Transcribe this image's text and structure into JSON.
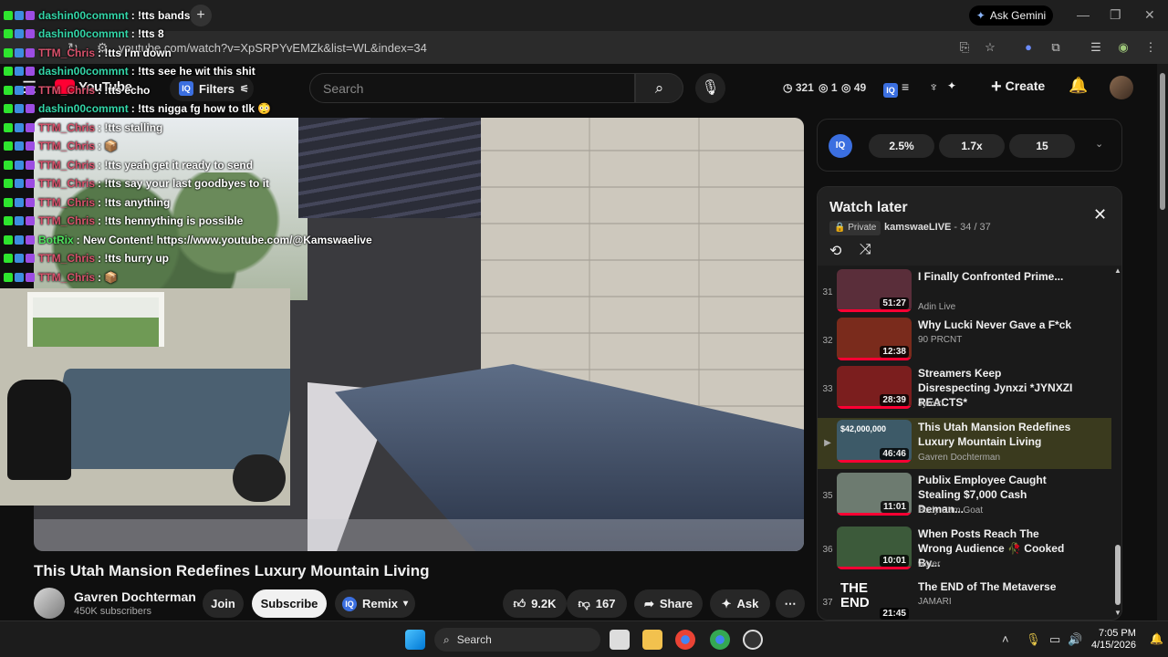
{
  "browser": {
    "gemini_label": "Ask Gemini",
    "url": "youtube.com/watch?v=XpSRPYvEMZk&list=WL&index=34"
  },
  "youtube": {
    "logo": "YouTube",
    "filters_label": "Filters",
    "search_placeholder": "Search",
    "stats": {
      "a": "321",
      "b": "1",
      "c": "49"
    },
    "create_label": "Create"
  },
  "chat": [
    {
      "user": "dashin00commnt",
      "color": "#33d6a8",
      "msg": ": !tts 8"
    },
    {
      "user": "TTM_Chris",
      "color": "#d9526c",
      "msg": ": !tts I'm down"
    },
    {
      "user": "dashin00commnt",
      "color": "#33d6a8",
      "msg": ": !tts see he wit this shit"
    },
    {
      "user": "TTM_Chris",
      "color": "#d9526c",
      "msg": ": !tts echo"
    },
    {
      "user": "dashin00commnt",
      "color": "#33d6a8",
      "msg": ": !tts nigga fg how to tlk 😳"
    },
    {
      "user": "TTM_Chris",
      "color": "#d9526c",
      "msg": ": !tts stalling"
    },
    {
      "user": "TTM_Chris",
      "color": "#d9526c",
      "msg": ": 📦"
    },
    {
      "user": "TTM_Chris",
      "color": "#d9526c",
      "msg": ": !tts yeah get it ready to send"
    },
    {
      "user": "TTM_Chris",
      "color": "#d9526c",
      "msg": ": !tts say your last goodbyes to it"
    },
    {
      "user": "TTM_Chris",
      "color": "#d9526c",
      "msg": ": !tts anything"
    },
    {
      "user": "TTM_Chris",
      "color": "#d9526c",
      "msg": ": !tts hennything is possible"
    },
    {
      "user": "BotRix",
      "color": "#4ee35e",
      "msg": ": New Content! https://www.youtube.com/@Kamswaelive"
    },
    {
      "user": "TTM_Chris",
      "color": "#d9526c",
      "msg": ": !tts hurry up"
    },
    {
      "user": "TTM_Chris",
      "color": "#d9526c",
      "msg": ": 📦"
    }
  ],
  "chat_top": {
    "user": "dashin00commnt",
    "msg": ": !tts bands"
  },
  "video": {
    "title": "This Utah Mansion Redefines Luxury Mountain Living",
    "channel": "Gavren Dochterman",
    "subscribers": "450K subscribers",
    "join_label": "Join",
    "subscribe_label": "Subscribe",
    "remix_label": "Remix",
    "likes": "9.2K",
    "dislikes": "167",
    "share_label": "Share",
    "ask_label": "Ask"
  },
  "iq_panel": {
    "badge": "IQ",
    "v1": "2.5%",
    "v2": "1.7x",
    "v3": "15"
  },
  "watch_later": {
    "title": "Watch later",
    "privacy": "Private",
    "owner": "kamswaeLIVE",
    "count": " - 34 / 37",
    "items": [
      {
        "idx": "31",
        "title": "I Finally Confronted Prime...",
        "channel": "Adin Live",
        "duration": "51:27",
        "thumb": "#5a2e3a",
        "active": false
      },
      {
        "idx": "32",
        "title": "Why Lucki Never Gave a F*ck",
        "channel": "90 PRCNT",
        "duration": "12:38",
        "thumb": "#7a2b1c",
        "active": false
      },
      {
        "idx": "33",
        "title": "Streamers Keep Disrespecting Jynxzi *JYNXZI REACTS*",
        "channel": "Jynxzi",
        "duration": "28:39",
        "thumb": "#7b1e1e",
        "active": false
      },
      {
        "idx": "▶",
        "title": "This Utah Mansion Redefines Luxury Mountain Living",
        "channel": "Gavren Dochterman",
        "duration": "46:46",
        "thumb": "#3d5a68",
        "active": true,
        "overlay": "$42,000,000"
      },
      {
        "idx": "35",
        "title": "Publix Employee Caught Stealing $7,000 Cash Deman...",
        "channel": "Body Cam Goat",
        "duration": "11:01",
        "thumb": "#6d7b70",
        "active": false
      },
      {
        "idx": "36",
        "title": "When Posts Reach The Wrong Audience 🥀 Cooked By...",
        "channel": "woter",
        "duration": "10:01",
        "thumb": "#3c5a3a",
        "active": false
      },
      {
        "idx": "37",
        "title": "The END of The Metaverse",
        "channel": "JAMARI",
        "duration": "21:45",
        "thumb": "#1a1a1a",
        "active": false,
        "overlay": "THE END"
      }
    ]
  },
  "taskbar": {
    "search_label": "Search",
    "time": "7:05 PM",
    "date": "4/15/2026"
  }
}
